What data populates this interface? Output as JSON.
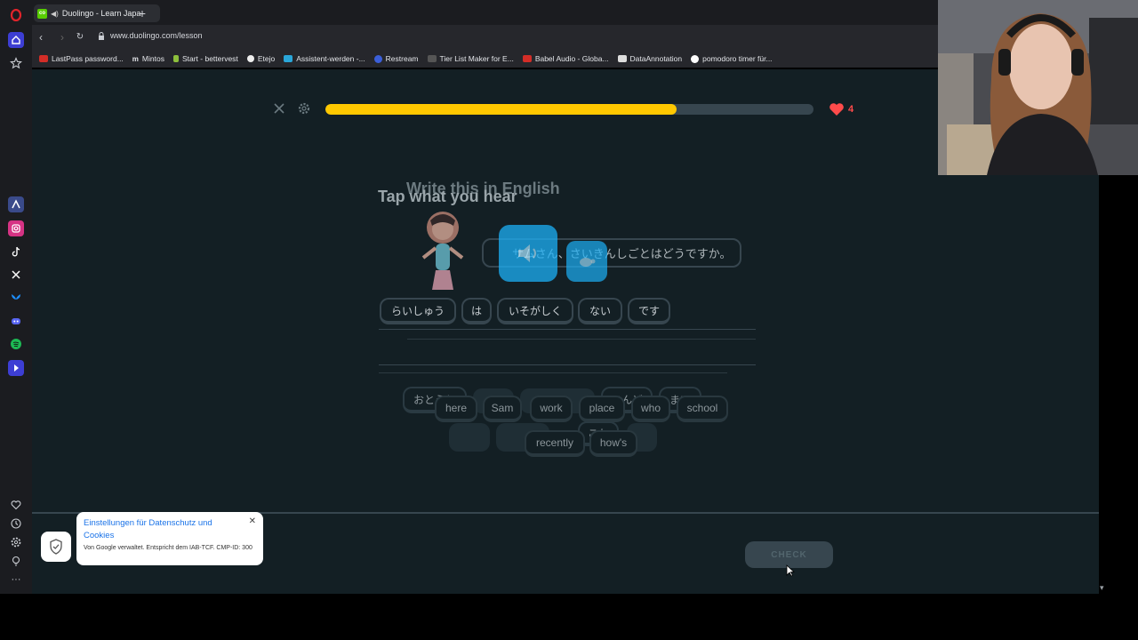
{
  "browser": {
    "tab_title": "Duolingo - Learn Japa",
    "url": "www.duolingo.com/lesson",
    "bookmarks": [
      {
        "label": "LastPass password...",
        "color": "#d32d27"
      },
      {
        "label": "Mintos",
        "color": "#1b1c20"
      },
      {
        "label": "Start - bettervest",
        "color": "#8dbf3c"
      },
      {
        "label": "Etejo",
        "color": "#eeeeee"
      },
      {
        "label": "Assistent-werden -...",
        "color": "#2aa6d9"
      },
      {
        "label": "Restream",
        "color": "#3b5fd9"
      },
      {
        "label": "Tier List Maker for E...",
        "color": "#555555"
      },
      {
        "label": "Babel Audio - Globa...",
        "color": "#d32d27"
      },
      {
        "label": "DataAnnotation",
        "color": "#dddddd"
      },
      {
        "label": "pomodoro timer für...",
        "color": "#ffffff"
      }
    ]
  },
  "lesson": {
    "progress": 0.72,
    "hearts": "4",
    "title_ghost": "Write this in English",
    "title": "Tap what you hear",
    "sentence": "サムさん、さいきんしごとはどうですか。",
    "answer_chips_jp": [
      "らいしゅう",
      "は",
      "いそがしく",
      "ない",
      "です"
    ],
    "word_bank_jp": [
      "おとうと",
      "こんど",
      "まで",
      "これ"
    ],
    "word_bank_en": [
      "here",
      "Sam",
      "work",
      "place",
      "who",
      "school",
      "recently",
      "how's"
    ],
    "check_label": "CHECK"
  },
  "consent": {
    "title": "Einstellungen für Datenschutz und Cookies",
    "subtitle": "Von Google verwaltet. Entspricht dem IAB-TCF. CMP-ID: 300"
  }
}
